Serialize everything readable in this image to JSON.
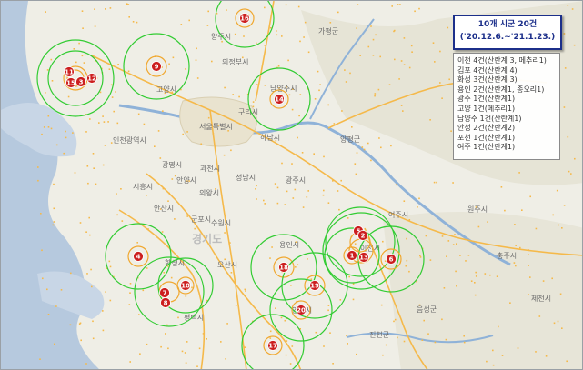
{
  "title": {
    "line1": "10개 시군 20건",
    "line2": "('20.12.6.~'21.1.23.)"
  },
  "legend": [
    "이천 4건(산란계 3, 메추리1)",
    "김포 4건(산란계 4)",
    "화성 3건(산란계 3)",
    "용인 2건(산란계1, 종오리1)",
    "광주 1건(산란계1)",
    "고양 1건(메추리1)",
    "남양주 1건(산란계1)",
    "안성 2건(산란계2)",
    "포천 1건(산란계1)",
    "여주 1건(산란계1)"
  ],
  "map_labels": {
    "goyang": "고양시",
    "yangju": "양주시",
    "uijeongbu": "의정부시",
    "gapyeong": "가평군",
    "namyangju": "남양주시",
    "guri": "구리시",
    "seoul": "서울특별시",
    "hanam": "하남시",
    "incheon": "인천광역시",
    "yangpyeong": "양평군",
    "gwangmyeong": "광명시",
    "gwacheon": "과천시",
    "seongnam": "성남시",
    "siheung": "시흥시",
    "anyang": "안양시",
    "uiwang": "의왕시",
    "gwangju": "광주시",
    "ansan": "안산시",
    "gunpo": "군포시",
    "gyeonggido": "경기도",
    "suwon": "수원시",
    "yongin": "용인시",
    "icheon": "이천시",
    "yeoju": "여주시",
    "hwaseong": "화성시",
    "osan": "오산시",
    "pyeongtaek": "평택시",
    "anseong": "안성시",
    "chungju": "충주시",
    "jecheon": "제천시",
    "wonju": "원주시",
    "eumseong": "음성군",
    "jincheon": "진천군",
    "ansong2": "안성"
  },
  "markers": [
    {
      "label": "11"
    },
    {
      "label": "3"
    },
    {
      "label": "12"
    },
    {
      "label": "15"
    },
    {
      "label": "9"
    },
    {
      "label": "16"
    },
    {
      "label": "14"
    },
    {
      "label": "4"
    },
    {
      "label": "7"
    },
    {
      "label": "8"
    },
    {
      "label": "10"
    },
    {
      "label": "5"
    },
    {
      "label": "2"
    },
    {
      "label": "1"
    },
    {
      "label": "6"
    },
    {
      "label": "13"
    },
    {
      "label": "19"
    },
    {
      "label": "20"
    },
    {
      "label": "18"
    },
    {
      "label": "17"
    }
  ],
  "colors": {
    "land": "#efeee6",
    "sea": "#b6c9de",
    "river": "#8fb2d8",
    "road": "#f5b94a",
    "ring_outer": "#33cc33",
    "ring_inner": "#f0a830",
    "marker_fill": "#cc1f1f",
    "title_border": "#1c2f8a"
  }
}
